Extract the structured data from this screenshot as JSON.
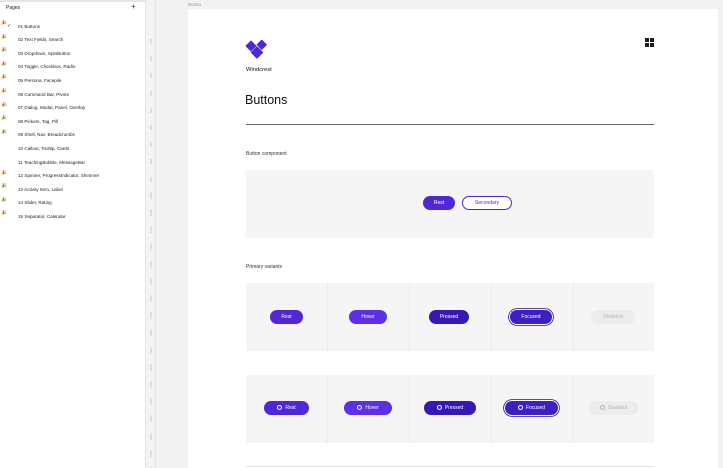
{
  "sidebar": {
    "title": "Pages",
    "add_icon": "plus-icon",
    "items": [
      {
        "label": "01 Buttons",
        "spark": true,
        "selected": true
      },
      {
        "label": "02 Text Fields, Search",
        "spark": true
      },
      {
        "label": "03 Dropdown, SpinButton",
        "spark": true
      },
      {
        "label": "04 Toggle, Checkbox, Radio",
        "spark": true
      },
      {
        "label": "05 Persona, Facepile",
        "spark": true
      },
      {
        "label": "06 Command Bar, Pivots",
        "spark": true
      },
      {
        "label": "07 Dialog, Modal, Panel, Overlay",
        "spark": true
      },
      {
        "label": "08 Pickers, Tag, Pill",
        "spark": true
      },
      {
        "label": "09 Shell, Nav, Breadcrumbs",
        "spark": true
      },
      {
        "label": "10 Callout, Tooltip, Cards",
        "spark": false
      },
      {
        "label": "11 TeachingBubble, MessageBar",
        "spark": false
      },
      {
        "label": "12 Spinner, ProgressIndicator, Shimmer",
        "spark": true
      },
      {
        "label": "13 Activity Item, Label",
        "spark": true
      },
      {
        "label": "14 Slider, Rating",
        "spark": true
      },
      {
        "label": "15 Separator, Calendar",
        "spark": true
      }
    ],
    "spark_glyph": "🎉"
  },
  "ruler": {
    "labels": [
      "100",
      "200",
      "300",
      "400",
      "500",
      "600",
      "700",
      "800",
      "900",
      "1000",
      "1100",
      "1200",
      "1300",
      "1400",
      "1500",
      "1600",
      "1700",
      "1800",
      "1900",
      "2000",
      "2100",
      "2200",
      "2300",
      "2400",
      "2500",
      "2600"
    ]
  },
  "canvas": {
    "frame_label": "Button",
    "brand": "Windcrest",
    "page_title": "Buttons",
    "sections": {
      "component": {
        "label": "Button component",
        "buttons": {
          "primary": "Rest",
          "secondary": "Secondary"
        }
      },
      "primary_variants": {
        "label": "Primary variants",
        "row1": [
          "Rest",
          "Hover",
          "Pressed",
          "Focused",
          "Disabled"
        ],
        "row2": [
          "Rest",
          "Hover",
          "Pressed",
          "Focused",
          "Disabled"
        ]
      }
    }
  },
  "colors": {
    "accent": "#4f27d7",
    "accent_dark": "#3818b3",
    "disabled_bg": "#ececec",
    "disabled_text": "#b3b3b3",
    "panel": "#f5f5f5"
  }
}
